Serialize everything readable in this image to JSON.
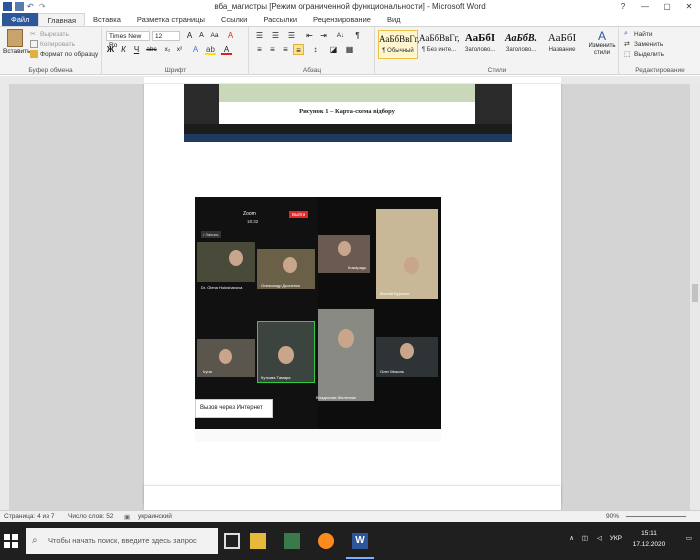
{
  "window": {
    "title": "вба_магистры [Режим ограниченной функциональности]  -  Microsoft Word",
    "controls": [
      "?",
      "—",
      "▢",
      "✕"
    ]
  },
  "tabs": [
    "Файл",
    "Главная",
    "Вставка",
    "Разметка страницы",
    "Ссылки",
    "Рассылки",
    "Рецензирование",
    "Вид"
  ],
  "clipboard": {
    "paste": "Вставить",
    "cut": "Вырезать",
    "copy": "Копировать",
    "format": "Формат по образцу",
    "label": "Буфер обмена"
  },
  "font": {
    "name": "Times New Ro",
    "size": "12",
    "label": "Шрифт"
  },
  "paragraph": {
    "label": "Абзац"
  },
  "styles": {
    "items": [
      {
        "preview": "АаБбВвГг,",
        "name": "¶ Обычный"
      },
      {
        "preview": "АаБбВвГг,",
        "name": "¶ Без инте..."
      },
      {
        "preview": "АаБбІ",
        "name": "Заголово..."
      },
      {
        "preview": "АаБбВ.",
        "name": "Заголово..."
      },
      {
        "preview": "АаБбІ",
        "name": "Название"
      }
    ],
    "change": "Изменить стили",
    "label": "Стили"
  },
  "editing": {
    "find": "Найти",
    "replace": "Заменить",
    "select": "Выделить",
    "label": "Редактирование"
  },
  "document": {
    "caption": "Рисунок 1 – Карта-схема відбору",
    "zoom_title": "Zoom",
    "zoom_time": "18:32",
    "leave": "Выйти",
    "record": "• Запись",
    "popup": "Вызов через Интернет",
    "participants": [
      "Dr. Olena Holoshanova",
      "Олександр Дьяченко",
      "Iryna",
      "Куткова Тамара",
      "Кожарадь",
      "Віталій Буренко",
      "Владислав Железняк",
      "Олег Миколь"
    ]
  },
  "status": {
    "page": "Страница: 4 из 7",
    "words": "Число слов: 52",
    "lang": "украинский",
    "zoom": "90%"
  },
  "taskbar": {
    "search": "Чтобы начать поиск, введите здесь запрос",
    "lang": "УКР",
    "time": "15:11",
    "date": "17.12.2020"
  }
}
